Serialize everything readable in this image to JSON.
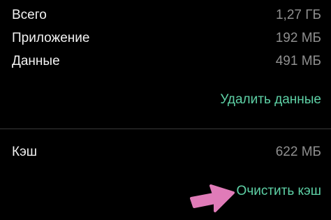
{
  "storage": {
    "total": {
      "label": "Всего",
      "value": "1,27 ГБ"
    },
    "app": {
      "label": "Приложение",
      "value": "192 МБ"
    },
    "data": {
      "label": "Данные",
      "value": "491 МБ"
    },
    "clear_data_label": "Удалить данные"
  },
  "cache": {
    "label": "Кэш",
    "value": "622 МБ",
    "clear_cache_label": "Очистить кэш"
  },
  "colors": {
    "accent": "#5ed1a6",
    "arrow": "#e07bb8",
    "background": "#000000",
    "secondary_text": "#8f8f8f"
  }
}
